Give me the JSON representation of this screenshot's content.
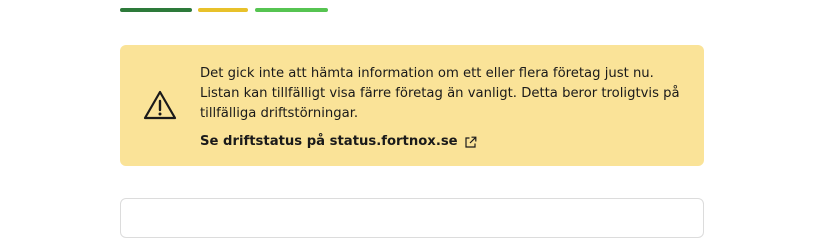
{
  "stripes": {
    "colors": [
      "#2d7a3a",
      "#e8c12a",
      "#56c451"
    ]
  },
  "alert": {
    "background": "#fae398",
    "icon": "warning-triangle-icon",
    "message": "Det gick inte att hämta information om ett eller flera företag just nu. Listan kan tillfälligt visa färre företag än vanligt. Detta beror troligtvis på tillfälliga driftstörningar.",
    "link_label": "Se driftstatus på status.fortnox.se",
    "link_icon": "external-link-icon"
  }
}
